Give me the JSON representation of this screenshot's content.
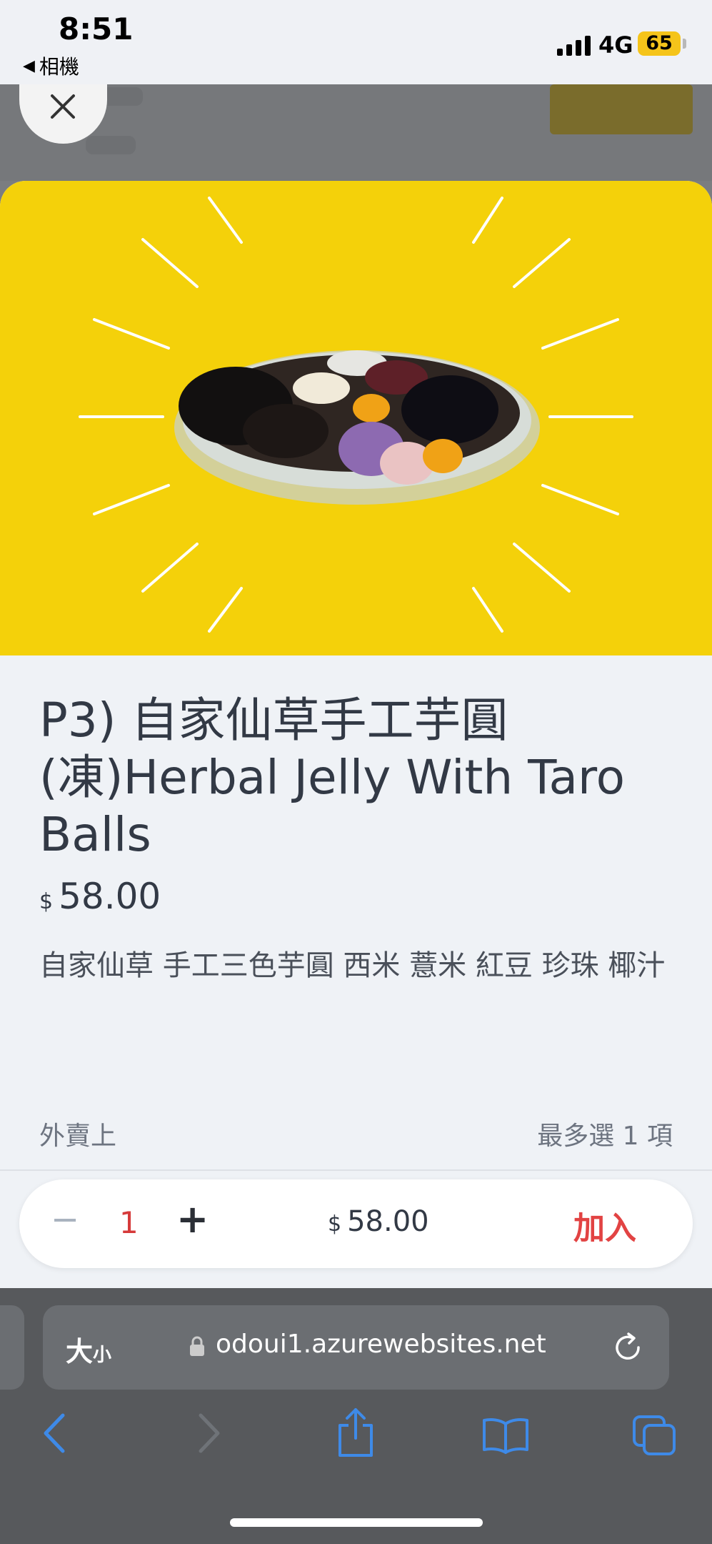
{
  "status_bar": {
    "time": "8:51",
    "back_app": "相機",
    "network": "4G",
    "battery": "65"
  },
  "product": {
    "title": "P3) 自家仙草手工芋圓(凍)Herbal Jelly With Taro Balls",
    "currency": "$",
    "price": "58.00",
    "description": "自家仙草 手工三色芋圓 西米 薏米 紅豆 珍珠 椰汁"
  },
  "options": {
    "label": "外賣上",
    "limit": "最多選 1 項"
  },
  "cart_bar": {
    "minus": "−",
    "quantity": "1",
    "plus": "+",
    "currency": "$",
    "total": "58.00",
    "add_label": "加入"
  },
  "browser": {
    "text_size_big": "大",
    "text_size_small": "小",
    "url": "odoui1.azurewebsites.net"
  },
  "colors": {
    "hero_background": "#f4d10a",
    "accent_red": "#e24343",
    "safari_blue": "#3e8ae8"
  },
  "icons": {
    "close": "close-icon",
    "lock": "lock-icon",
    "reload": "reload-icon",
    "back": "chevron-left-icon",
    "forward": "chevron-right-icon",
    "share": "share-icon",
    "bookmarks": "book-icon",
    "tabs": "tabs-icon"
  }
}
